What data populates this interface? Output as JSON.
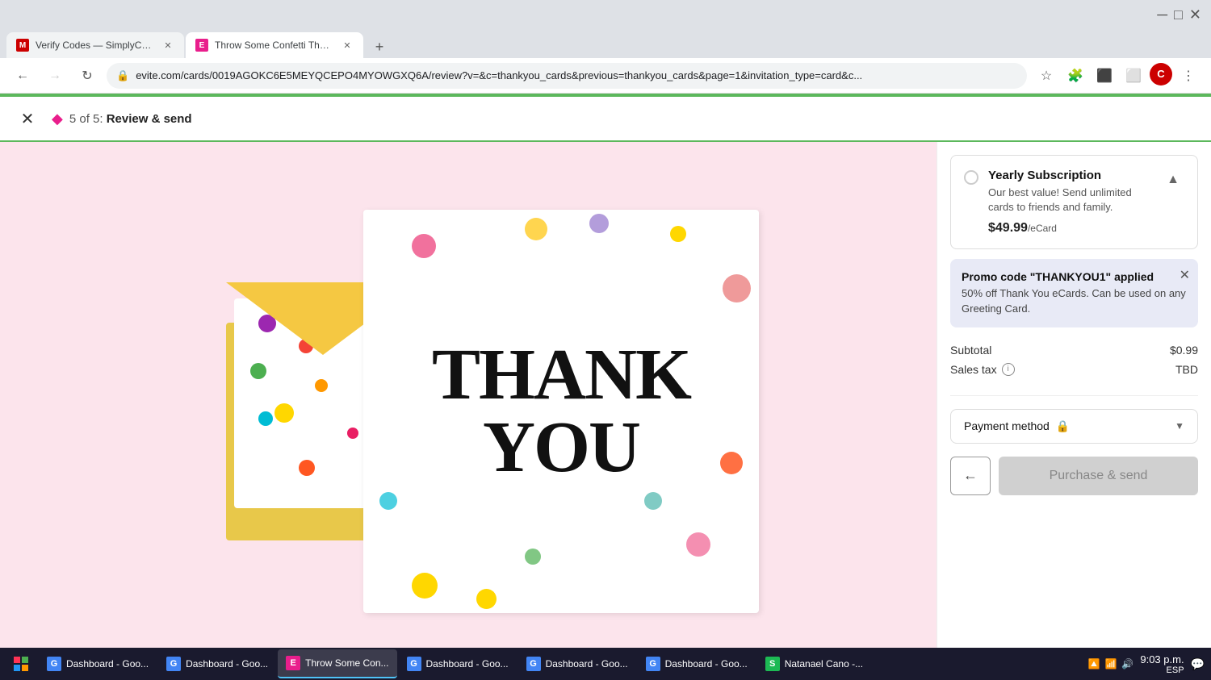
{
  "browser": {
    "tabs": [
      {
        "id": "tab1",
        "favicon_color": "#c00",
        "favicon_letter": "M",
        "title": "Verify Codes — SimplyCodes",
        "active": false
      },
      {
        "id": "tab2",
        "favicon_color": "#e91e8c",
        "favicon_letter": "E",
        "title": "Throw Some Confetti Thank Yo...",
        "active": true
      }
    ],
    "address": "evite.com/cards/0019AGOKC6E5MEYQCEPO4MYOWGXQ6A/review?v=&c=thankyou_cards&previous=thankyou_cards&page=1&invitation_type=card&c...",
    "new_tab_label": "+"
  },
  "nav": {
    "back_disabled": false,
    "forward_disabled": false
  },
  "topbar": {
    "step": "5 of 5:",
    "step_detail": "Review & send"
  },
  "subscription": {
    "title": "Yearly Subscription",
    "description": "Our best value! Send unlimited cards to friends and family.",
    "price": "$49.99",
    "per": "/eCard"
  },
  "promo": {
    "title": "Promo code \"THANKYOU1\" applied",
    "description": "50% off Thank You eCards. Can be used on any Greeting Card."
  },
  "totals": {
    "subtotal_label": "Subtotal",
    "subtotal_value": "$0.99",
    "tax_label": "Sales tax",
    "tax_value": "TBD"
  },
  "payment": {
    "label": "Payment method"
  },
  "buttons": {
    "back_arrow": "←",
    "purchase": "Purchase & send"
  },
  "card": {
    "thank_you_line1": "THANK",
    "thank_you_line2": "YOU"
  },
  "taskbar": {
    "time": "9:03 p.m.",
    "date": "ESP",
    "items": [
      {
        "label": "Dashboard - Goo...",
        "color": "#4285f4",
        "letter": "G"
      },
      {
        "label": "Dashboard - Goo...",
        "color": "#4285f4",
        "letter": "G"
      },
      {
        "label": "Throw Some Con...",
        "color": "#e91e8c",
        "letter": "E",
        "active": true
      },
      {
        "label": "Dashboard - Goo...",
        "color": "#4285f4",
        "letter": "G"
      },
      {
        "label": "Dashboard - Goo...",
        "color": "#4285f4",
        "letter": "G"
      },
      {
        "label": "Dashboard - Goo...",
        "color": "#4285f4",
        "letter": "G"
      },
      {
        "label": "Natanael Cano -...",
        "color": "#1db954",
        "letter": "S"
      }
    ]
  }
}
